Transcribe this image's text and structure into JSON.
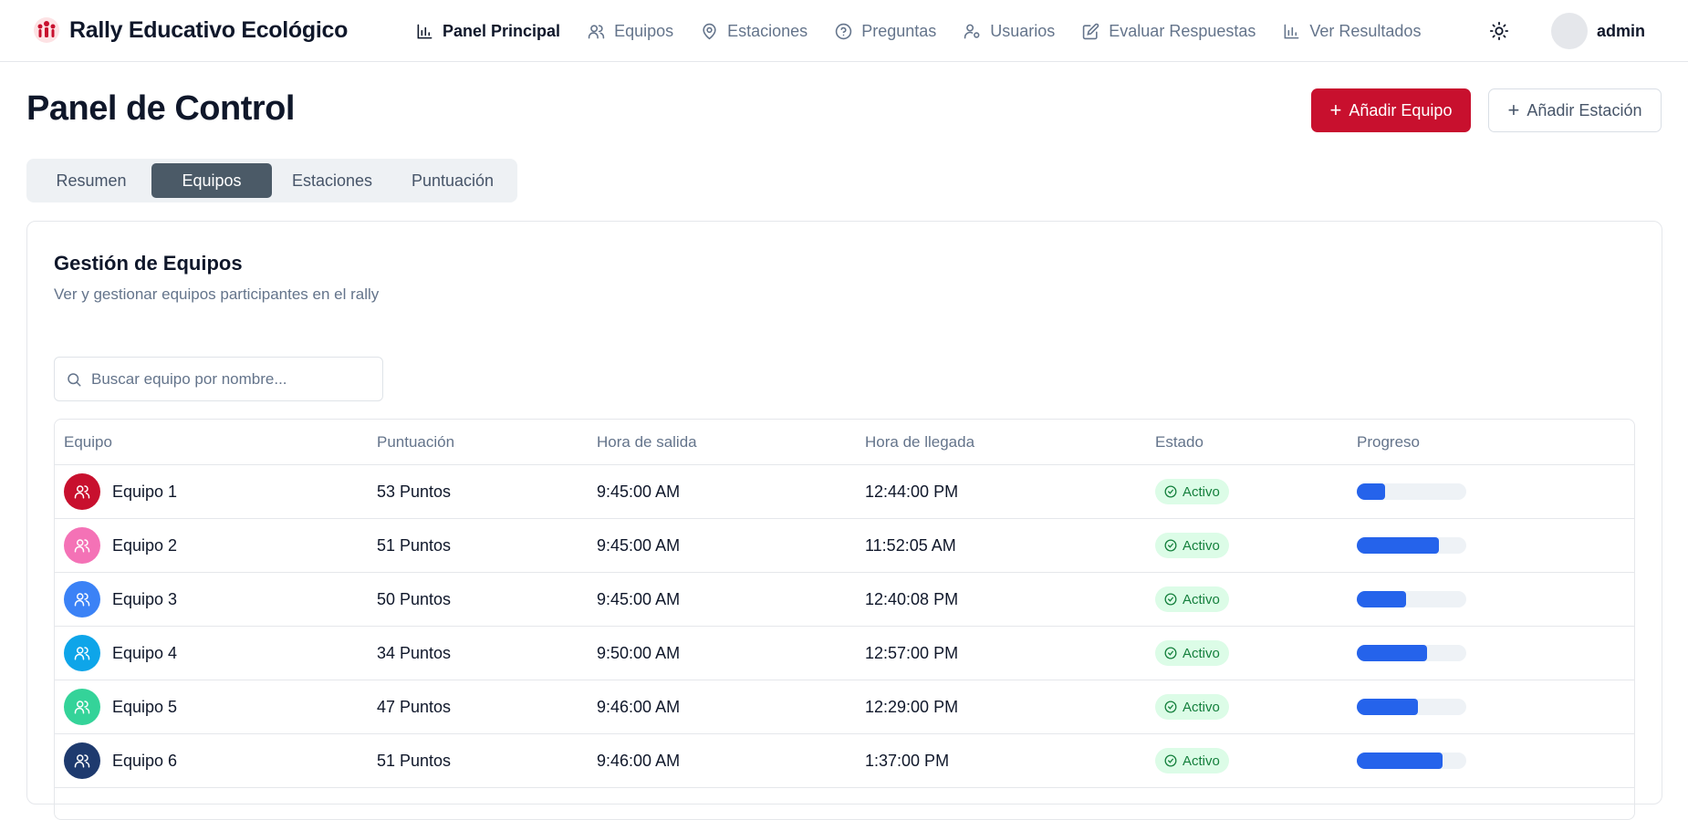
{
  "app": {
    "title": "Rally Educativo Ecológico"
  },
  "nav": [
    {
      "label": "Panel Principal",
      "icon": "bar-chart-icon",
      "active": true
    },
    {
      "label": "Equipos",
      "icon": "users-icon",
      "active": false
    },
    {
      "label": "Estaciones",
      "icon": "map-pin-icon",
      "active": false
    },
    {
      "label": "Preguntas",
      "icon": "help-circle-icon",
      "active": false
    },
    {
      "label": "Usuarios",
      "icon": "user-cog-icon",
      "active": false
    },
    {
      "label": "Evaluar Respuestas",
      "icon": "edit-icon",
      "active": false
    },
    {
      "label": "Ver Resultados",
      "icon": "bar-chart-icon",
      "active": false
    }
  ],
  "user": {
    "name": "admin"
  },
  "page": {
    "title": "Panel de Control",
    "add_team_label": "Añadir Equipo",
    "add_station_label": "Añadir Estación"
  },
  "tabs": [
    {
      "label": "Resumen",
      "active": false
    },
    {
      "label": "Equipos",
      "active": true
    },
    {
      "label": "Estaciones",
      "active": false
    },
    {
      "label": "Puntuación",
      "active": false
    }
  ],
  "card": {
    "title": "Gestión de Equipos",
    "subtitle": "Ver y gestionar equipos participantes en el rally"
  },
  "search": {
    "placeholder": "Buscar equipo por nombre..."
  },
  "table": {
    "headers": [
      "Equipo",
      "Puntuación",
      "Hora de salida",
      "Hora de llegada",
      "Estado",
      "Progreso"
    ],
    "rows": [
      {
        "team": "Equipo 1",
        "score": "53 Puntos",
        "departure": "9:45:00 AM",
        "arrival": "12:44:00 PM",
        "status": "Activo",
        "progress": 0.26,
        "color": "#c8102e"
      },
      {
        "team": "Equipo 2",
        "score": "51 Puntos",
        "departure": "9:45:00 AM",
        "arrival": "11:52:05 AM",
        "status": "Activo",
        "progress": 0.75,
        "color": "#f472b6"
      },
      {
        "team": "Equipo 3",
        "score": "50 Puntos",
        "departure": "9:45:00 AM",
        "arrival": "12:40:08 PM",
        "status": "Activo",
        "progress": 0.45,
        "color": "#3b82f6"
      },
      {
        "team": "Equipo 4",
        "score": "34 Puntos",
        "departure": "9:50:00 AM",
        "arrival": "12:57:00 PM",
        "status": "Activo",
        "progress": 0.64,
        "color": "#0ea5e9"
      },
      {
        "team": "Equipo 5",
        "score": "47 Puntos",
        "departure": "9:46:00 AM",
        "arrival": "12:29:00 PM",
        "status": "Activo",
        "progress": 0.56,
        "color": "#34d399"
      },
      {
        "team": "Equipo 6",
        "score": "51 Puntos",
        "departure": "9:46:00 AM",
        "arrival": "1:37:00 PM",
        "status": "Activo",
        "progress": 0.78,
        "color": "#1e3a6e"
      }
    ]
  }
}
